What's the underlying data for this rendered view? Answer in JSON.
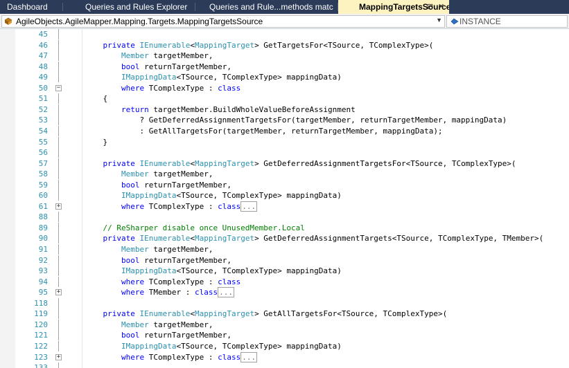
{
  "tabs": [
    {
      "label": "Dashboard",
      "active": false
    },
    {
      "label": "Queries and Rules Explorer",
      "active": false
    },
    {
      "label": "Queries and Rule...methods matc",
      "active": false
    },
    {
      "label": "MappingTargetsSource.cs",
      "active": true
    }
  ],
  "tab_icons": {
    "pin": "pin-icon",
    "close": "close-icon"
  },
  "nav": {
    "type_selector": "AgileObjects.AgileMapper.Mapping.Targets.MappingTargetsSource",
    "member_selector": "INSTANCE"
  },
  "colors": {
    "keyword": "#0000ff",
    "type": "#2b91af",
    "comment": "#008000",
    "line_number": "#2b91af",
    "active_tab_bg": "#fdf3c0",
    "tabstrip_bg": "#2b3b58"
  },
  "lines": [
    {
      "n": "45",
      "o": "v",
      "tokens": []
    },
    {
      "n": "46",
      "o": "v",
      "tokens": [
        [
          "    "
        ],
        [
          "private",
          "kw"
        ],
        [
          " "
        ],
        [
          "IEnumerable",
          "ty"
        ],
        [
          "<"
        ],
        [
          "MappingTarget",
          "ty"
        ],
        [
          "> GetTargetsFor<TSource, TComplexType>("
        ]
      ]
    },
    {
      "n": "47",
      "o": "v",
      "tokens": [
        [
          "        "
        ],
        [
          "Member",
          "ty"
        ],
        [
          " targetMember,"
        ]
      ]
    },
    {
      "n": "48",
      "o": "v",
      "tokens": [
        [
          "        "
        ],
        [
          "bool",
          "kw"
        ],
        [
          " returnTargetMember,"
        ]
      ]
    },
    {
      "n": "49",
      "o": "v",
      "tokens": [
        [
          "        "
        ],
        [
          "IMappingData",
          "ty"
        ],
        [
          "<TSource, TComplexType> mappingData)"
        ]
      ]
    },
    {
      "n": "50",
      "o": "-",
      "tokens": [
        [
          "        "
        ],
        [
          "where",
          "kw"
        ],
        [
          " TComplexType : "
        ],
        [
          "class",
          "kw"
        ]
      ]
    },
    {
      "n": "51",
      "o": "v",
      "tokens": [
        [
          "    {"
        ]
      ]
    },
    {
      "n": "52",
      "o": "v",
      "tokens": [
        [
          "        "
        ],
        [
          "return",
          "kw"
        ],
        [
          " targetMember.BuildWholeValueBeforeAssignment"
        ]
      ]
    },
    {
      "n": "53",
      "o": "v",
      "tokens": [
        [
          "            ? GetDeferredAssignmentTargetsFor(targetMember, returnTargetMember, mappingData)"
        ]
      ]
    },
    {
      "n": "54",
      "o": "v",
      "tokens": [
        [
          "            : GetAllTargetsFor(targetMember, returnTargetMember, mappingData);"
        ]
      ]
    },
    {
      "n": "55",
      "o": "v",
      "tokens": [
        [
          "    }"
        ]
      ]
    },
    {
      "n": "56",
      "o": "v",
      "tokens": []
    },
    {
      "n": "57",
      "o": "v",
      "tokens": [
        [
          "    "
        ],
        [
          "private",
          "kw"
        ],
        [
          " "
        ],
        [
          "IEnumerable",
          "ty"
        ],
        [
          "<"
        ],
        [
          "MappingTarget",
          "ty"
        ],
        [
          "> GetDeferredAssignmentTargetsFor<TSource, TComplexType>("
        ]
      ]
    },
    {
      "n": "58",
      "o": "v",
      "tokens": [
        [
          "        "
        ],
        [
          "Member",
          "ty"
        ],
        [
          " targetMember,"
        ]
      ]
    },
    {
      "n": "59",
      "o": "v",
      "tokens": [
        [
          "        "
        ],
        [
          "bool",
          "kw"
        ],
        [
          " returnTargetMember,"
        ]
      ]
    },
    {
      "n": "60",
      "o": "v",
      "tokens": [
        [
          "        "
        ],
        [
          "IMappingData",
          "ty"
        ],
        [
          "<TSource, TComplexType> mappingData)"
        ]
      ]
    },
    {
      "n": "61",
      "o": "+",
      "tokens": [
        [
          "        "
        ],
        [
          "where",
          "kw"
        ],
        [
          " TComplexType : "
        ],
        [
          "class",
          "kw"
        ],
        [
          "...",
          "collapsed"
        ]
      ]
    },
    {
      "n": "88",
      "o": "v",
      "tokens": []
    },
    {
      "n": "89",
      "o": "v",
      "tokens": [
        [
          "    "
        ],
        [
          "// ReSharper disable once UnusedMember.Local",
          "cm"
        ]
      ]
    },
    {
      "n": "90",
      "o": "v",
      "tokens": [
        [
          "    "
        ],
        [
          "private",
          "kw"
        ],
        [
          " "
        ],
        [
          "IEnumerable",
          "ty"
        ],
        [
          "<"
        ],
        [
          "MappingTarget",
          "ty"
        ],
        [
          "> GetDeferredAssignmentTargets<TSource, TComplexType, TMember>("
        ]
      ]
    },
    {
      "n": "91",
      "o": "v",
      "tokens": [
        [
          "        "
        ],
        [
          "Member",
          "ty"
        ],
        [
          " targetMember,"
        ]
      ]
    },
    {
      "n": "92",
      "o": "v",
      "tokens": [
        [
          "        "
        ],
        [
          "bool",
          "kw"
        ],
        [
          " returnTargetMember,"
        ]
      ]
    },
    {
      "n": "93",
      "o": "v",
      "tokens": [
        [
          "        "
        ],
        [
          "IMappingData",
          "ty"
        ],
        [
          "<TSource, TComplexType> mappingData)"
        ]
      ]
    },
    {
      "n": "94",
      "o": "v",
      "tokens": [
        [
          "        "
        ],
        [
          "where",
          "kw"
        ],
        [
          " TComplexType : "
        ],
        [
          "class",
          "kw"
        ]
      ]
    },
    {
      "n": "95",
      "o": "+",
      "tokens": [
        [
          "        "
        ],
        [
          "where",
          "kw"
        ],
        [
          " TMember : "
        ],
        [
          "class",
          "kw"
        ],
        [
          "...",
          "collapsed"
        ]
      ]
    },
    {
      "n": "118",
      "o": "v",
      "tokens": []
    },
    {
      "n": "119",
      "o": "v",
      "tokens": [
        [
          "    "
        ],
        [
          "private",
          "kw"
        ],
        [
          " "
        ],
        [
          "IEnumerable",
          "ty"
        ],
        [
          "<"
        ],
        [
          "MappingTarget",
          "ty"
        ],
        [
          "> GetAllTargetsFor<TSource, TComplexType>("
        ]
      ]
    },
    {
      "n": "120",
      "o": "v",
      "tokens": [
        [
          "        "
        ],
        [
          "Member",
          "ty"
        ],
        [
          " targetMember,"
        ]
      ]
    },
    {
      "n": "121",
      "o": "v",
      "tokens": [
        [
          "        "
        ],
        [
          "bool",
          "kw"
        ],
        [
          " returnTargetMember,"
        ]
      ]
    },
    {
      "n": "122",
      "o": "v",
      "tokens": [
        [
          "        "
        ],
        [
          "IMappingData",
          "ty"
        ],
        [
          "<TSource, TComplexType> mappingData)"
        ]
      ]
    },
    {
      "n": "123",
      "o": "+",
      "tokens": [
        [
          "        "
        ],
        [
          "where",
          "kw"
        ],
        [
          " TComplexType : "
        ],
        [
          "class",
          "kw"
        ],
        [
          "...",
          "collapsed"
        ]
      ]
    },
    {
      "n": "133",
      "o": "v",
      "tokens": []
    }
  ]
}
